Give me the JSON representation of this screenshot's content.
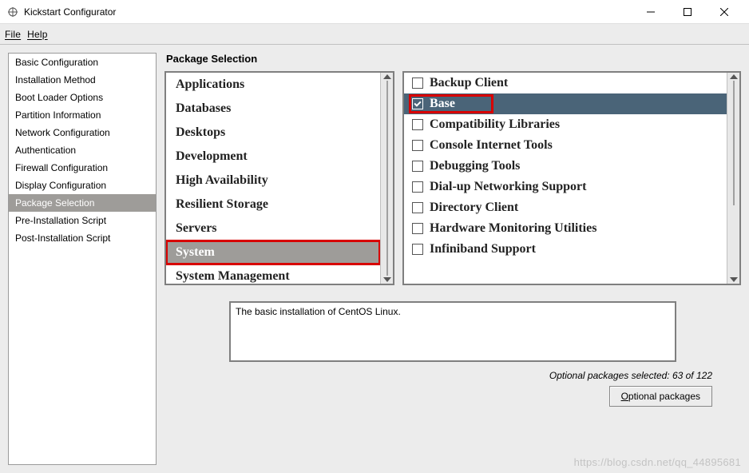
{
  "window": {
    "title": "Kickstart Configurator"
  },
  "menu": {
    "file": "File",
    "help": "Help"
  },
  "sidebar": {
    "items": [
      "Basic Configuration",
      "Installation Method",
      "Boot Loader Options",
      "Partition Information",
      "Network Configuration",
      "Authentication",
      "Firewall Configuration",
      "Display Configuration",
      "Package Selection",
      "Pre-Installation Script",
      "Post-Installation Script"
    ],
    "selected_index": 8
  },
  "main": {
    "title": "Package Selection",
    "categories": [
      "Applications",
      "Databases",
      "Desktops",
      "Development",
      "High Availability",
      "Resilient Storage",
      "Servers",
      "System",
      "System Management"
    ],
    "selected_category_index": 7,
    "highlighted_category_index": 7,
    "packages": [
      {
        "label": "Backup Client",
        "checked": false
      },
      {
        "label": "Base",
        "checked": true
      },
      {
        "label": "Compatibility Libraries",
        "checked": false
      },
      {
        "label": "Console Internet Tools",
        "checked": false
      },
      {
        "label": "Debugging Tools",
        "checked": false
      },
      {
        "label": "Dial-up Networking Support",
        "checked": false
      },
      {
        "label": "Directory Client",
        "checked": false
      },
      {
        "label": "Hardware Monitoring Utilities",
        "checked": false
      },
      {
        "label": "Infiniband Support",
        "checked": false
      }
    ],
    "selected_package_index": 1,
    "highlighted_package_index": 1,
    "description": "The basic installation of CentOS Linux.",
    "status": "Optional packages selected: 63 of 122",
    "optional_button": "Optional packages"
  },
  "watermark": "https://blog.csdn.net/qq_44895681"
}
